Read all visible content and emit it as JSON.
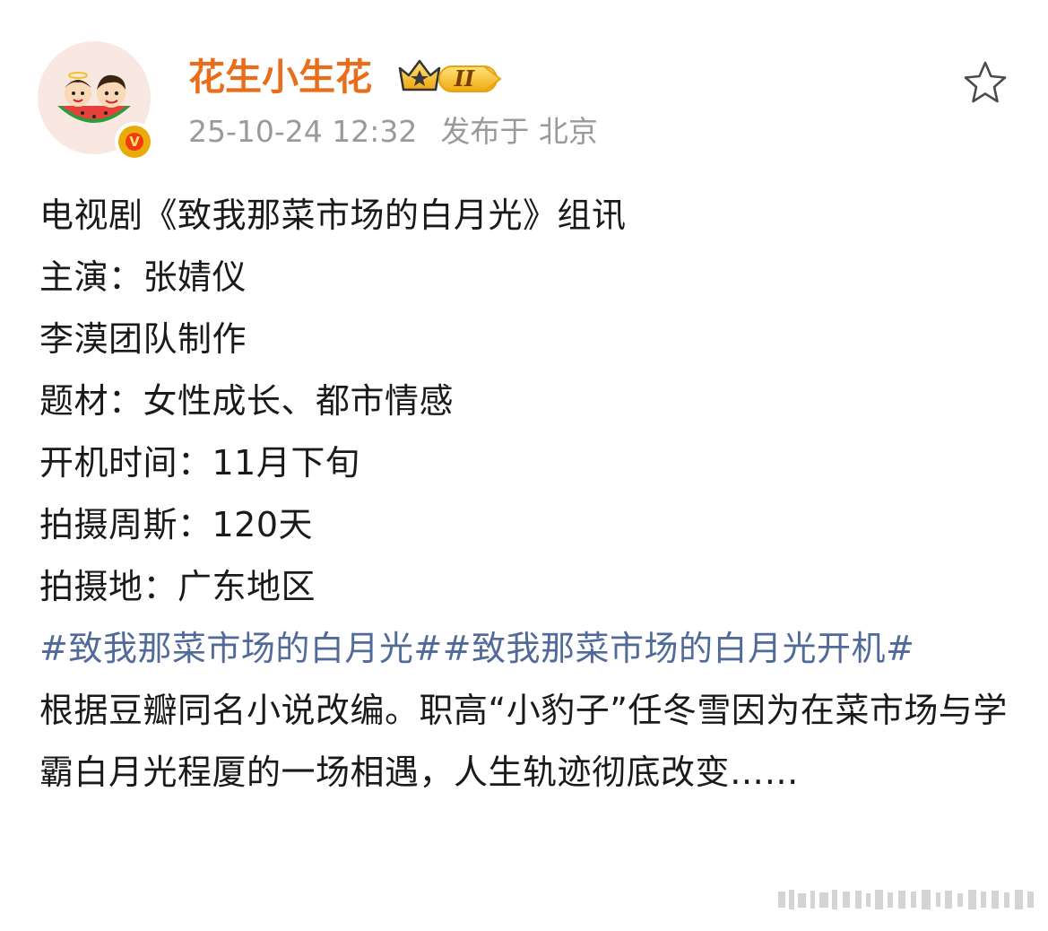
{
  "user": {
    "name": "花生小生花",
    "level_badge": "II",
    "verified_mark": "V",
    "timestamp": "25-10-24 12:32",
    "location_text": "发布于 北京"
  },
  "icons": {
    "favorite": "star-outline-icon",
    "crown": "crown-icon"
  },
  "colors": {
    "username": "#ea6d1c",
    "topic_link": "#506a99",
    "meta": "#9a9a9a",
    "badge_gold": "#f3b81c",
    "verified_red": "#f23a10"
  },
  "post": {
    "lines": [
      "电视剧《致我那菜市场的白月光》组讯",
      "主演：张婧仪",
      "李漠团队制作",
      "题材：女性成长、都市情感",
      "开机时间：11月下旬",
      "拍摄周斯：120天",
      "拍摄地：广东地区"
    ],
    "topics": [
      "#致我那菜市场的白月光#",
      "#致我那菜市场的白月光开机#"
    ],
    "body": "根据豆瓣同名小说改编。职高“小豹子”任冬雪因为在菜市场与学霸白月光程厦的一场相遇，人生轨迹彻底改变……"
  }
}
